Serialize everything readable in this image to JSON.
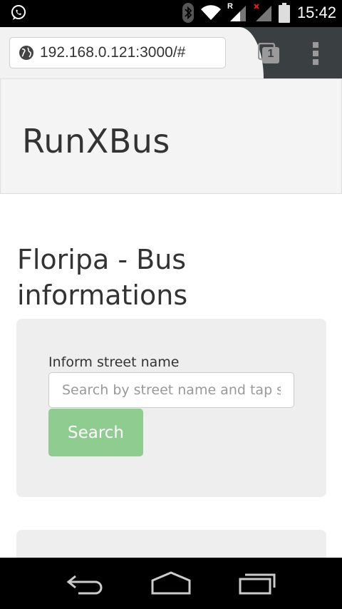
{
  "status_bar": {
    "time": "15:42",
    "network_label": "R",
    "icons": [
      "whatsapp-icon",
      "bluetooth-icon",
      "wifi-icon",
      "signal-icon",
      "signal-no-data-icon",
      "battery-icon"
    ]
  },
  "browser": {
    "url": "192.168.0.121:3000/#",
    "tab_count": "1"
  },
  "page": {
    "brand": "RunXBus",
    "title": "Floripa - Bus informations",
    "search": {
      "label": "Inform street name",
      "placeholder": "Search by street name and tap search",
      "value": "",
      "button_label": "Search"
    }
  },
  "colors": {
    "search_button": "#8fcc8f",
    "card_background": "#eeeeee",
    "jumbotron_background": "#f4f4f4",
    "browser_chrome": "#3a3f42"
  }
}
